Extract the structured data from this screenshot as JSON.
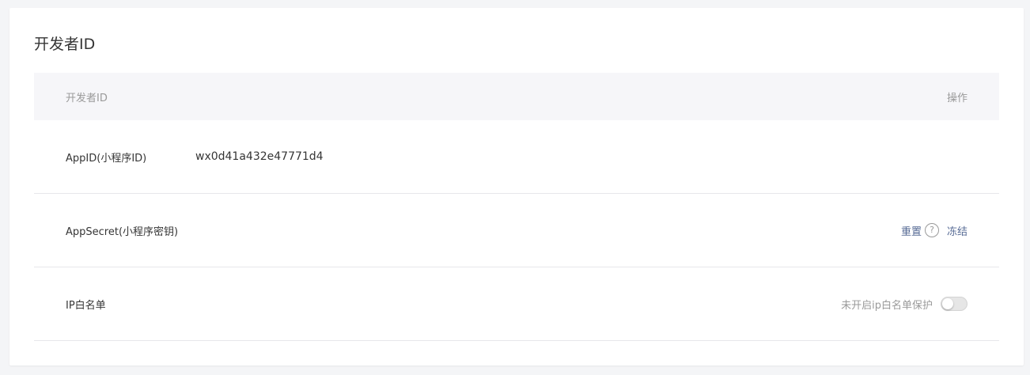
{
  "card": {
    "title": "开发者ID"
  },
  "table": {
    "header": {
      "col_id": "开发者ID",
      "col_action": "操作"
    },
    "rows": {
      "appid": {
        "label": "AppID(小程序ID)",
        "value": "wx0d41a432e47771d4"
      },
      "appsecret": {
        "label": "AppSecret(小程序密钥)",
        "reset": "重置",
        "help": "?",
        "freeze": "冻结"
      },
      "ip_whitelist": {
        "label": "IP白名单",
        "status": "未开启ip白名单保护",
        "toggle_on": false
      }
    }
  },
  "colors": {
    "link": "#576b95",
    "muted": "#9a9a9a",
    "text": "#353535"
  }
}
